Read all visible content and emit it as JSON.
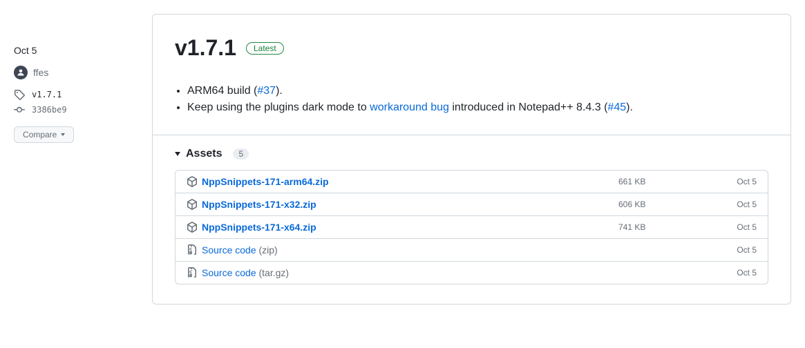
{
  "sidebar": {
    "release_date": "Oct 5",
    "author": "ffes",
    "tag": "v1.7.1",
    "commit": "3386be9",
    "compare_label": "Compare"
  },
  "release": {
    "title": "v1.7.1",
    "badge": "Latest",
    "changelog": [
      {
        "prefix": "ARM64 build (",
        "link": "#37",
        "suffix": ")."
      },
      {
        "prefix": "Keep using the plugins dark mode to ",
        "link1": "workaround bug",
        "middle": " introduced in Notepad++ 8.4.3 (",
        "link2": "#45",
        "suffix": ")."
      }
    ]
  },
  "assets": {
    "label": "Assets",
    "count": "5",
    "items": [
      {
        "type": "package",
        "name": "NppSnippets-171-arm64.zip",
        "size": "661 KB",
        "date": "Oct 5"
      },
      {
        "type": "package",
        "name": "NppSnippets-171-x32.zip",
        "size": "606 KB",
        "date": "Oct 5"
      },
      {
        "type": "package",
        "name": "NppSnippets-171-x64.zip",
        "size": "741 KB",
        "date": "Oct 5"
      },
      {
        "type": "source",
        "name": "Source code",
        "format": "(zip)",
        "size": "",
        "date": "Oct 5"
      },
      {
        "type": "source",
        "name": "Source code",
        "format": "(tar.gz)",
        "size": "",
        "date": "Oct 5"
      }
    ]
  }
}
